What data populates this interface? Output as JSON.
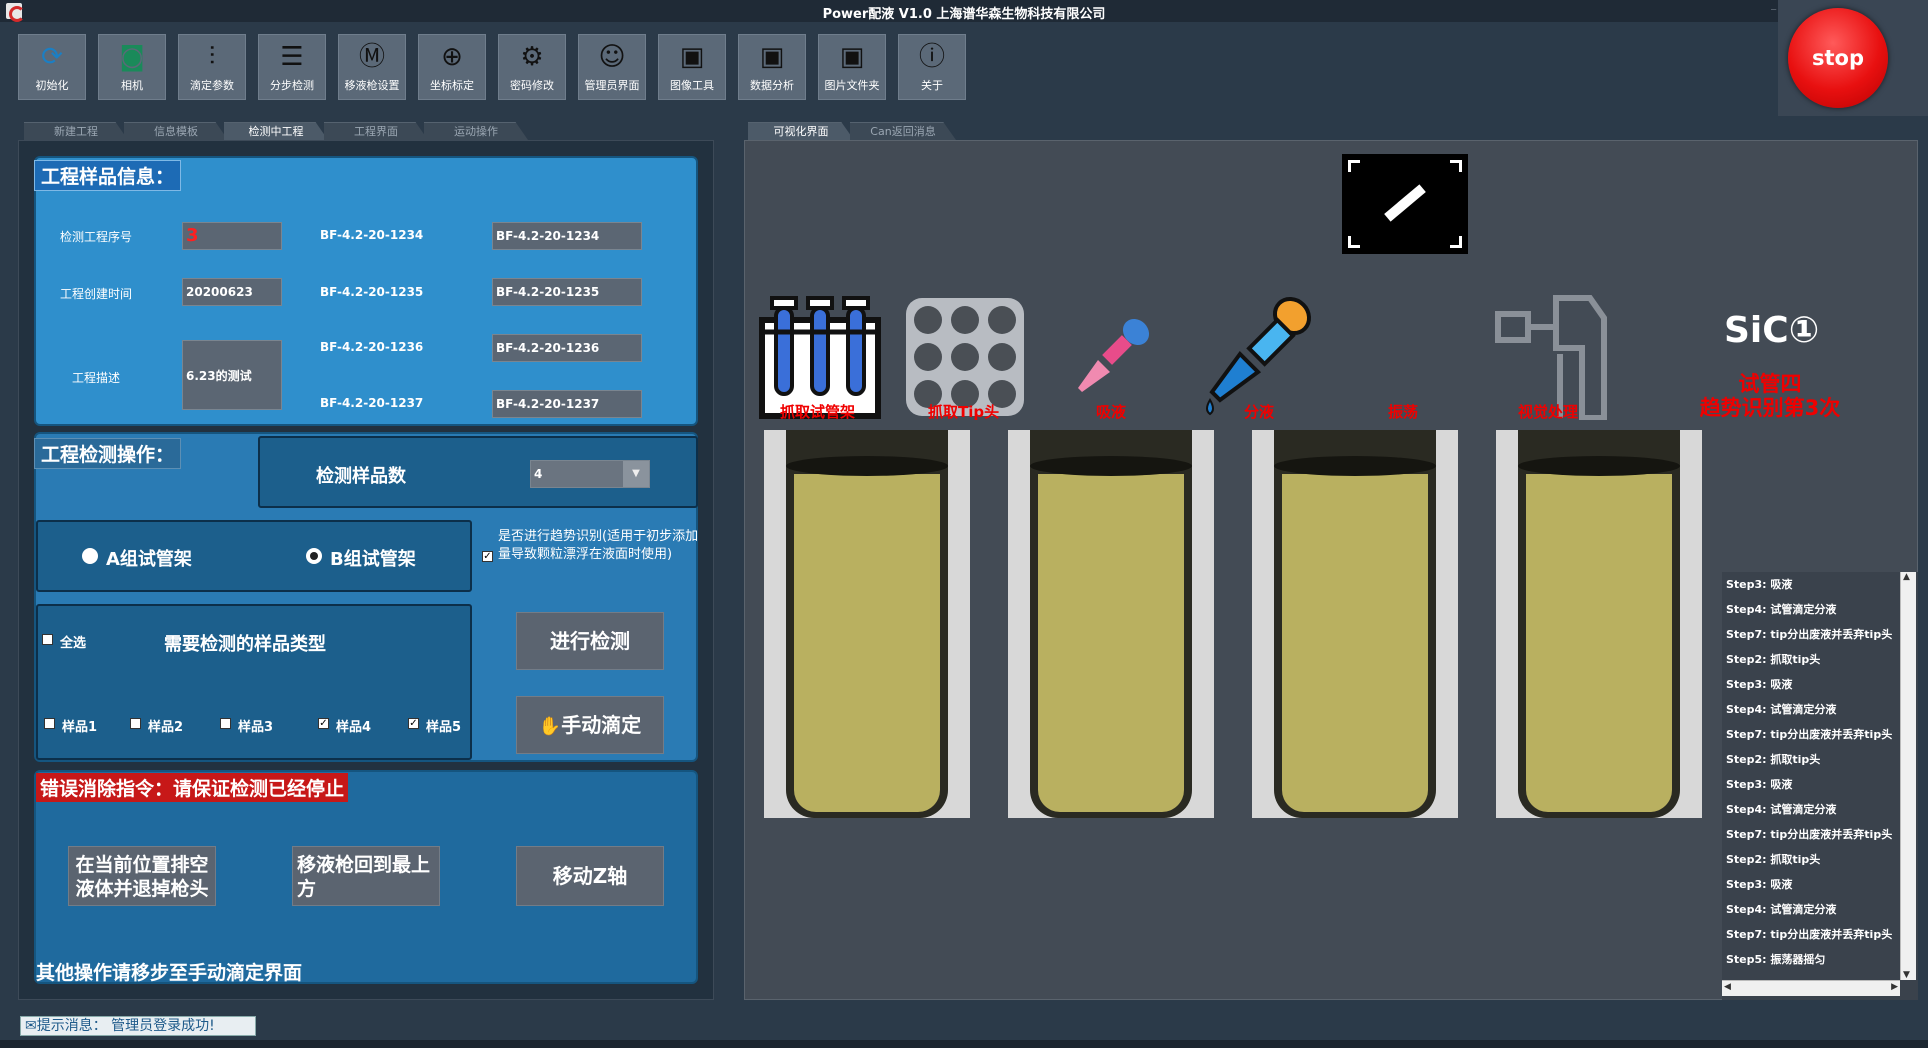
{
  "window": {
    "title": "Power配液 V1.0 上海谱华森生物科技有限公司"
  },
  "toolbar": {
    "items": [
      {
        "label": "初始化"
      },
      {
        "label": "相机"
      },
      {
        "label": "滴定参数"
      },
      {
        "label": "分步检测"
      },
      {
        "label": "移液枪设置"
      },
      {
        "label": "坐标标定"
      },
      {
        "label": "密码修改"
      },
      {
        "label": "管理员界面"
      },
      {
        "label": "图像工具"
      },
      {
        "label": "数据分析"
      },
      {
        "label": "图片文件夹"
      },
      {
        "label": "关于"
      }
    ],
    "stop_label": "stop"
  },
  "left_tabs": [
    "新建工程",
    "信息模板",
    "检测中工程",
    "工程界面",
    "运动操作"
  ],
  "right_tabs": [
    "可视化界面",
    "Can返回消息"
  ],
  "sample_info": {
    "title": "工程样品信息：",
    "serial_label": "检测工程序号",
    "serial_value": "3",
    "created_label": "工程创建时间",
    "created_value": "20200623",
    "desc_label": "工程描述",
    "desc_value": "6.23的测试",
    "codes": [
      "BF-4.2-20-1234",
      "BF-4.2-20-1235",
      "BF-4.2-20-1236",
      "BF-4.2-20-1237"
    ],
    "code_values": [
      "BF-4.2-20-1234",
      "BF-4.2-20-1235",
      "BF-4.2-20-1236",
      "BF-4.2-20-1237"
    ]
  },
  "operation": {
    "title": "工程检测操作：",
    "count_label": "检测样品数",
    "count_value": "4",
    "rack_a": "A组试管架",
    "rack_b": "B组试管架",
    "trend_text": "是否进行趋势识别(适用于初步添加量导致颗粒漂浮在液面时使用)",
    "select_all": "全选",
    "types_title": "需要检测的样品类型",
    "samples": [
      {
        "label": "样品1",
        "checked": ""
      },
      {
        "label": "样品2",
        "checked": ""
      },
      {
        "label": "样品3",
        "checked": ""
      },
      {
        "label": "样品4",
        "checked": "✓"
      },
      {
        "label": "样品5",
        "checked": "✓"
      }
    ],
    "run_button": "进行检测",
    "manual_button": "手动滴定"
  },
  "error": {
    "title": "错误消除指令：请保证检测已经停止",
    "empty_button": "在当前位置排空液体并退掉枪头",
    "return_button": "移液枪回到最上方",
    "z_button": "移动Z轴",
    "note": "其他操作请移步至手动滴定界面"
  },
  "visual": {
    "sic_label": "SiC①",
    "status_line1": "试管四",
    "status_line2": "趋势识别第3次",
    "steps": [
      "抓取试管架",
      "抓取Tip头",
      "吸液",
      "分液",
      "振荡",
      "视觉处理"
    ]
  },
  "log": [
    "Step3: 吸液",
    "Step4: 试管滴定分液",
    "Step7: tip分出废液并丢弃tip头",
    "Step2: 抓取tip头",
    "Step3: 吸液",
    "Step4: 试管滴定分液",
    "Step7: tip分出废液并丢弃tip头",
    "Step2: 抓取tip头",
    "Step3: 吸液",
    "Step4: 试管滴定分液",
    "Step7: tip分出废液并丢弃tip头",
    "Step2: 抓取tip头",
    "Step3: 吸液",
    "Step4: 试管滴定分液",
    "Step7: tip分出废液并丢弃tip头",
    "Step5: 振荡器摇匀"
  ],
  "status": {
    "message": "提示消息：  管理员登录成功!"
  },
  "colors": {
    "stop": "#e81010",
    "accent_blue": "#2f8fcc",
    "alert_red": "#f00000"
  }
}
